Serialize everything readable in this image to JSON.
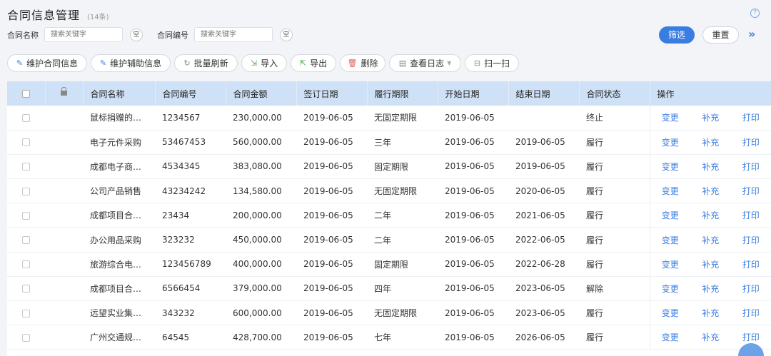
{
  "header": {
    "title": "合同信息管理",
    "count": "(14条)"
  },
  "filters": [
    {
      "label": "合同名称",
      "placeholder": "搜索关键字",
      "empty": "空"
    },
    {
      "label": "合同编号",
      "placeholder": "搜索关键字",
      "empty": "空"
    }
  ],
  "actions": {
    "filter": "筛选",
    "reset": "重置",
    "expand": "»"
  },
  "toolbar": {
    "maintain_contract": "维护合同信息",
    "maintain_aux": "维护辅助信息",
    "batch_refresh": "批量刷新",
    "import": "导入",
    "export": "导出",
    "delete": "删除",
    "view_log": "查看日志",
    "scan": "扫一扫"
  },
  "table": {
    "columns": [
      "合同名称",
      "合同编号",
      "合同金额",
      "签订日期",
      "履行期限",
      "开始日期",
      "结束日期",
      "合同状态",
      "操作"
    ],
    "operations": [
      "变更",
      "补充",
      "打印"
    ],
    "rows": [
      [
        "鼠标捐赠的…",
        "1234567",
        "230,000.00",
        "2019-06-05",
        "无固定期限",
        "2019-06-05",
        "",
        "终止"
      ],
      [
        "电子元件采购",
        "53467453",
        "560,000.00",
        "2019-06-05",
        "三年",
        "2019-06-05",
        "2019-06-05",
        "履行"
      ],
      [
        "成都电子商…",
        "4534345",
        "383,080.00",
        "2019-06-05",
        "固定期限",
        "2019-06-05",
        "2019-06-05",
        "履行"
      ],
      [
        "公司产品销售",
        "43234242",
        "134,580.00",
        "2019-06-05",
        "无固定期限",
        "2019-06-05",
        "2020-06-05",
        "履行"
      ],
      [
        "成都项目合…",
        "23434",
        "200,000.00",
        "2019-06-05",
        "二年",
        "2019-06-05",
        "2021-06-05",
        "履行"
      ],
      [
        "办公用品采购",
        "323232",
        "450,000.00",
        "2019-06-05",
        "二年",
        "2019-06-05",
        "2022-06-05",
        "履行"
      ],
      [
        "旅游综合电…",
        "123456789",
        "400,000.00",
        "2019-06-05",
        "固定期限",
        "2019-06-05",
        "2022-06-28",
        "履行"
      ],
      [
        "成都项目合…",
        "6566454",
        "379,000.00",
        "2019-06-05",
        "四年",
        "2019-06-05",
        "2023-06-05",
        "解除"
      ],
      [
        "远望实业集…",
        "343232",
        "600,000.00",
        "2019-06-05",
        "无固定期限",
        "2019-06-05",
        "2023-06-05",
        "履行"
      ],
      [
        "广州交通规…",
        "64545",
        "428,700.00",
        "2019-06-05",
        "七年",
        "2019-06-05",
        "2026-06-05",
        "履行"
      ]
    ]
  }
}
